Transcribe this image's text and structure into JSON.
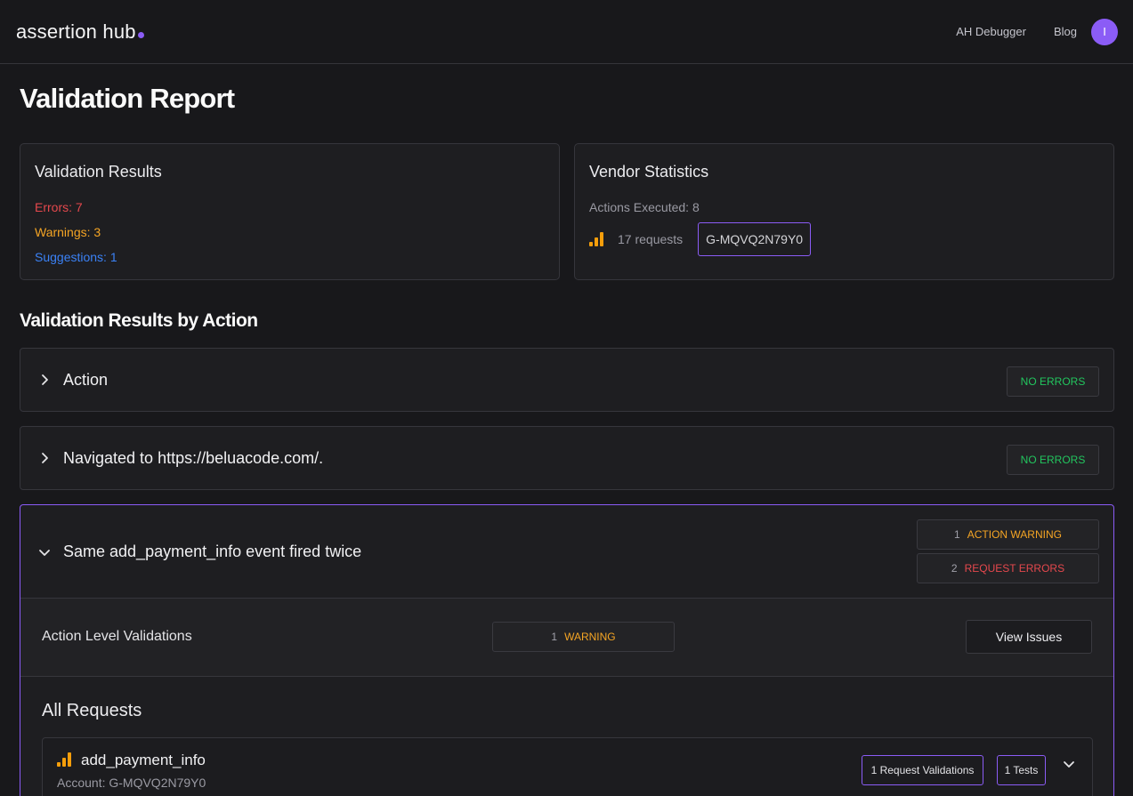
{
  "header": {
    "logo_text": "assertion hub",
    "nav": [
      "AH Debugger",
      "Blog"
    ],
    "avatar_initial": "I"
  },
  "page_title": "Validation Report",
  "validation_results": {
    "title": "Validation Results",
    "errors": "Errors: 7",
    "warnings": "Warnings: 3",
    "suggestions": "Suggestions: 1"
  },
  "vendor_statistics": {
    "title": "Vendor Statistics",
    "actions_executed": "Actions Executed: 8",
    "requests": "17 requests",
    "account_id": "G-MQVQ2N79Y0",
    "icon": "analytics-bars-icon"
  },
  "section_title": "Validation Results by Action",
  "actions": [
    {
      "title": "Action",
      "status": "NO ERRORS"
    },
    {
      "title": "Navigated to https://beluacode.com/.",
      "status": "NO ERRORS"
    }
  ],
  "expanded_action": {
    "title": "Same add_payment_info event fired twice",
    "badges": [
      {
        "count": "1",
        "label": "ACTION WARNING"
      },
      {
        "count": "2",
        "label": "REQUEST ERRORS"
      }
    ],
    "action_level": {
      "label": "Action Level Validations",
      "count": "1",
      "badge_label": "WARNING",
      "button": "View Issues"
    },
    "all_requests_title": "All Requests",
    "request": {
      "name": "add_payment_info",
      "account": "Account: G-MQVQ2N79Y0",
      "validations": "1 Request Validations",
      "tests": "1 Tests"
    }
  },
  "colors": {
    "accent": "#8b5cf6",
    "error": "#e5484d",
    "warning": "#f5a524",
    "suggestion": "#3b82f6",
    "success": "#22c55e"
  }
}
